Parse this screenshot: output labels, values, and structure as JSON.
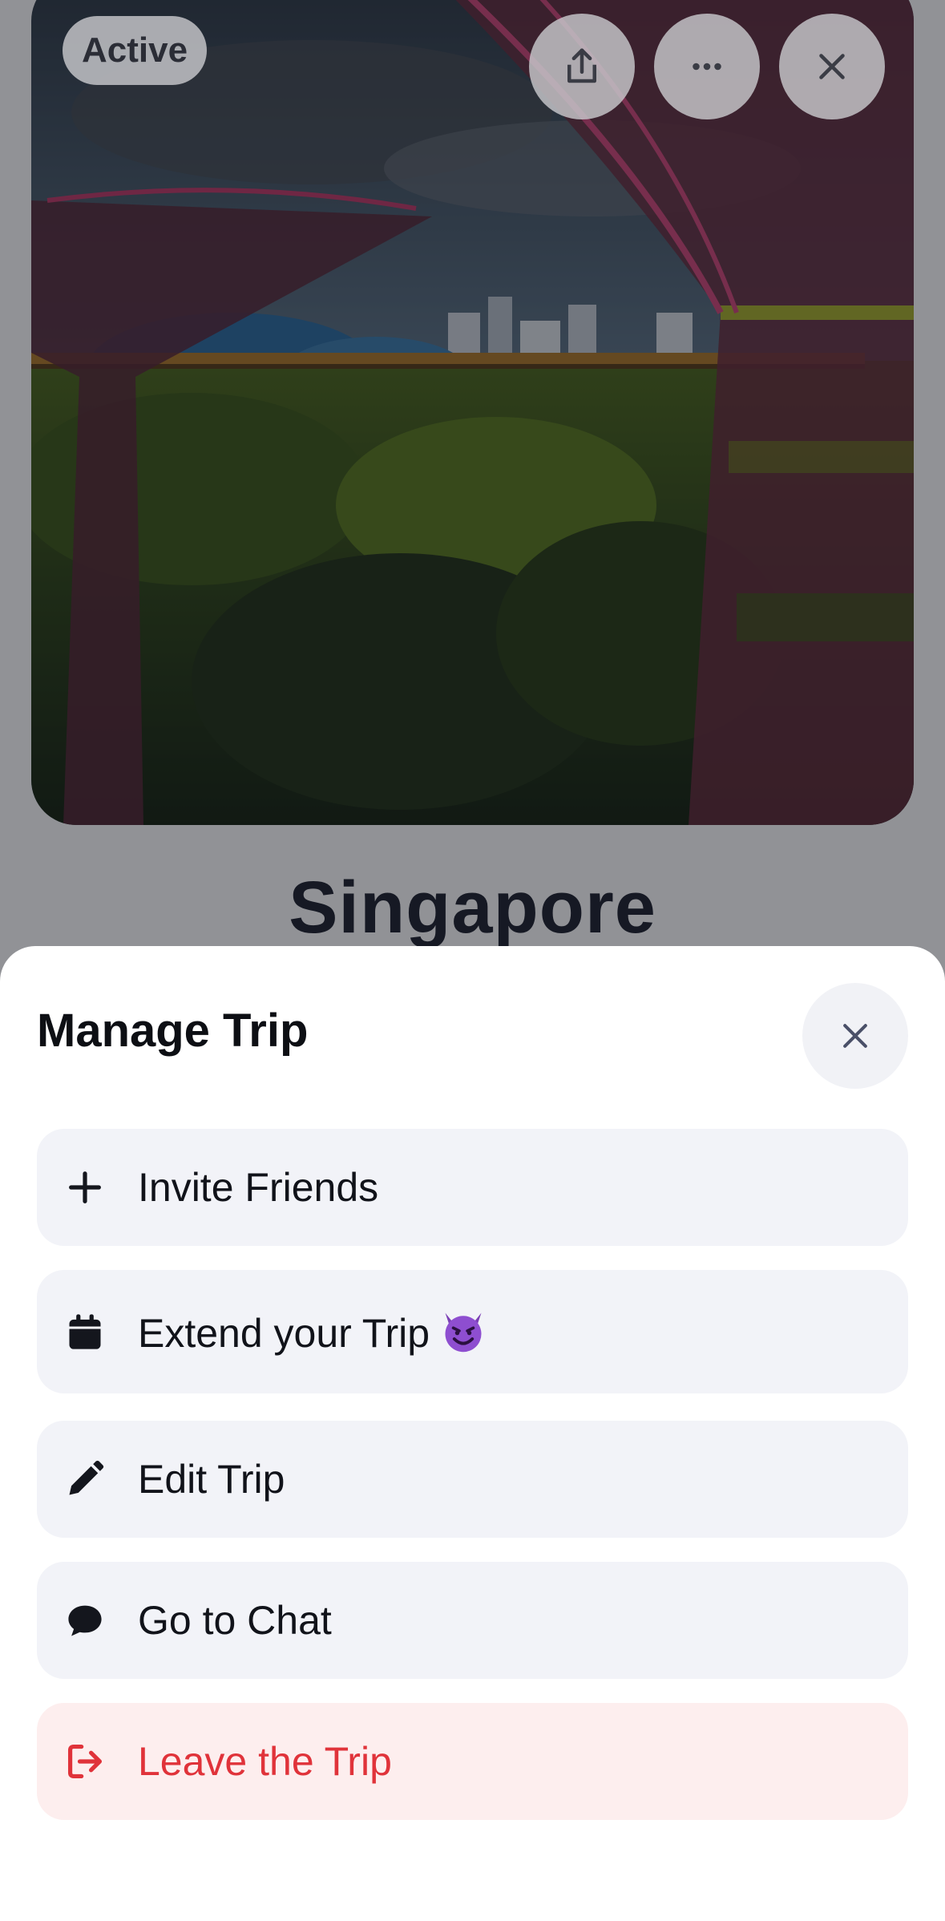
{
  "trip": {
    "status_badge": "Active",
    "city": "Singapore"
  },
  "sheet": {
    "title": "Manage Trip",
    "items": [
      {
        "label": "Invite Friends",
        "icon": "plus-icon"
      },
      {
        "label": "Extend your Trip",
        "icon": "calendar-icon",
        "emoji": "smiling-imp-emoji"
      },
      {
        "label": "Edit Trip",
        "icon": "pencil-icon"
      },
      {
        "label": "Go to Chat",
        "icon": "chat-bubble-icon"
      },
      {
        "label": "Leave the Trip",
        "icon": "leave-icon",
        "danger": true
      }
    ]
  },
  "colors": {
    "danger": "#e0333a",
    "danger_bg": "#fdeeee",
    "item_bg": "#f2f3f8",
    "overlay": "rgba(12,14,22,0.45)"
  }
}
